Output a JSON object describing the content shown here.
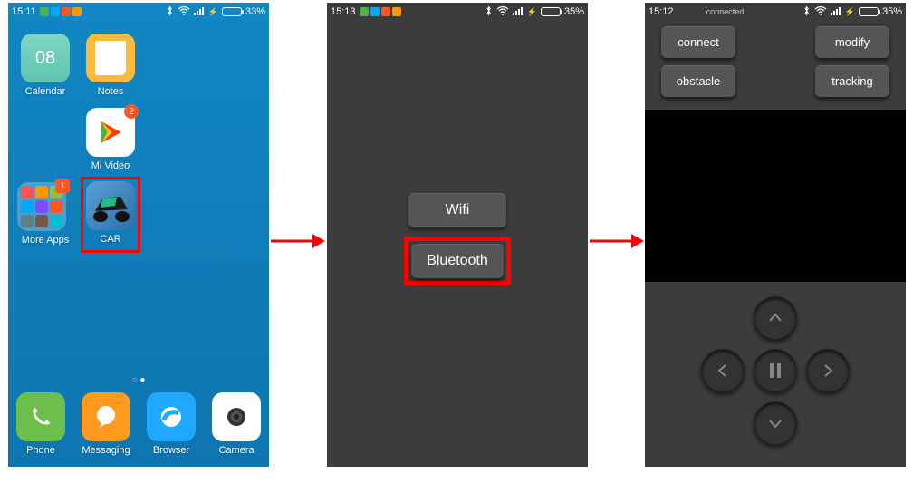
{
  "status": {
    "s1": {
      "time": "15:11",
      "battery": "33%",
      "pct": 33
    },
    "s2": {
      "time": "15:13",
      "battery": "35%",
      "pct": 35
    },
    "s3": {
      "time": "15:12",
      "connected": "connected",
      "battery": "35%",
      "pct": 35
    }
  },
  "home": {
    "calendar": {
      "label": "Calendar",
      "day": "08"
    },
    "notes": {
      "label": "Notes"
    },
    "mivideo": {
      "label": "Mi Video",
      "badge": "2"
    },
    "moreapps": {
      "label": "More Apps",
      "badge": "1"
    },
    "car": {
      "label": "CAR"
    }
  },
  "dock": {
    "phone": {
      "label": "Phone"
    },
    "messaging": {
      "label": "Messaging"
    },
    "browser": {
      "label": "Browser"
    },
    "camera": {
      "label": "Camera"
    }
  },
  "screen2": {
    "wifi": "Wifi",
    "bluetooth": "Bluetooth"
  },
  "screen3": {
    "connect": "connect",
    "modify": "modify",
    "obstacle": "obstacle",
    "tracking": "tracking"
  },
  "noti_colors": [
    "#4caf50",
    "#03a9f4",
    "#ff5722",
    "#ff9800"
  ],
  "folder_colors": [
    "#ff5252",
    "#ff9800",
    "#8bc34a",
    "#03a9f4",
    "#7c4dff",
    "#ff5722",
    "#607d8b",
    "#795548",
    "#00bcd4"
  ]
}
